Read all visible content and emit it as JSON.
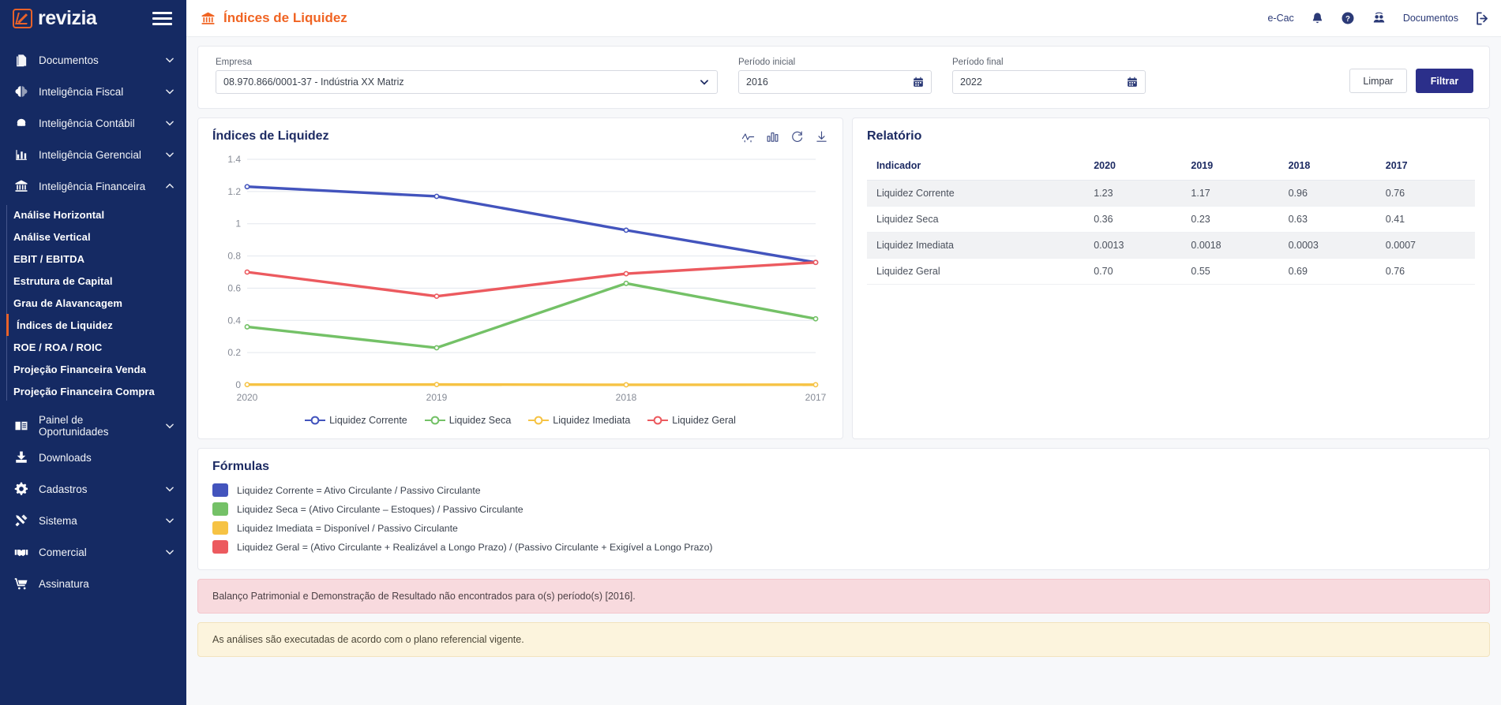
{
  "brand": {
    "name": "revizia",
    "logo_icon": "revizia-logo-icon",
    "menu_icon": "hamburger-icon"
  },
  "sidebar": {
    "items": [
      {
        "label": "Documentos",
        "icon": "documents-icon",
        "expandable": true,
        "expanded": false
      },
      {
        "label": "Inteligência Fiscal",
        "icon": "brain-icon",
        "expandable": true,
        "expanded": false
      },
      {
        "label": "Inteligência Contábil",
        "icon": "cloud-icon",
        "expandable": true,
        "expanded": false
      },
      {
        "label": "Inteligência Gerencial",
        "icon": "bar-chart-icon",
        "expandable": true,
        "expanded": false
      },
      {
        "label": "Inteligência Financeira",
        "icon": "bank-icon",
        "expandable": true,
        "expanded": true
      }
    ],
    "financeira_subitems": [
      {
        "label": "Análise Horizontal",
        "active": false
      },
      {
        "label": "Análise Vertical",
        "active": false
      },
      {
        "label": "EBIT / EBITDA",
        "active": false
      },
      {
        "label": "Estrutura de Capital",
        "active": false
      },
      {
        "label": "Grau de Alavancagem",
        "active": false
      },
      {
        "label": "Índices de Liquidez",
        "active": true
      },
      {
        "label": "ROE / ROA / ROIC",
        "active": false
      },
      {
        "label": "Projeção Financeira Venda",
        "active": false
      },
      {
        "label": "Projeção Financeira Compra",
        "active": false
      }
    ],
    "items_bottom": [
      {
        "label": "Painel de Oportunidades",
        "icon": "book-icon",
        "expandable": true
      },
      {
        "label": "Downloads",
        "icon": "download-icon",
        "expandable": false
      },
      {
        "label": "Cadastros",
        "icon": "gear-icon",
        "expandable": true
      },
      {
        "label": "Sistema",
        "icon": "tools-icon",
        "expandable": true
      },
      {
        "label": "Comercial",
        "icon": "handshake-icon",
        "expandable": true
      },
      {
        "label": "Assinatura",
        "icon": "cart-icon",
        "expandable": false
      }
    ]
  },
  "topbar": {
    "title": "Índices de Liquidez",
    "title_icon": "bank-icon",
    "ecac_label": "e-Cac",
    "bell_icon": "bell-icon",
    "help_icon": "question-circle-icon",
    "users_icon": "users-icon",
    "documents_label": "Documentos",
    "logout_icon": "logout-icon"
  },
  "filters": {
    "empresa": {
      "label": "Empresa",
      "value": "08.970.866/0001-37 - Indústria XX Matriz",
      "caret_icon": "chevron-down-icon"
    },
    "periodo_inicial": {
      "label": "Período inicial",
      "value": "2016",
      "icon": "calendar-icon"
    },
    "periodo_final": {
      "label": "Período final",
      "value": "2022",
      "icon": "calendar-icon"
    },
    "clear_label": "Limpar",
    "filter_label": "Filtrar"
  },
  "chart_panel": {
    "title": "Índices de Liquidez",
    "tools": [
      {
        "icon": "line-chart-icon",
        "name": "line-chart-toggle"
      },
      {
        "icon": "bar-chart-icon",
        "name": "bar-chart-toggle"
      },
      {
        "icon": "refresh-icon",
        "name": "refresh-button"
      },
      {
        "icon": "download-icon",
        "name": "download-button"
      }
    ]
  },
  "chart_data": {
    "type": "line",
    "title": "Índices de Liquidez",
    "xlabel": "",
    "ylabel": "",
    "categories": [
      "2020",
      "2019",
      "2018",
      "2017"
    ],
    "ylim": [
      0,
      1.4
    ],
    "yticks": [
      0,
      0.2,
      0.4,
      0.6,
      0.8,
      1,
      1.2,
      1.4
    ],
    "ytick_labels": [
      "0",
      "0.2",
      "0.4",
      "0.6",
      "0.8",
      "1",
      "1.2",
      "1.4"
    ],
    "grid": true,
    "legend_position": "bottom",
    "series": [
      {
        "name": "Liquidez Corrente",
        "color": "#4354bd",
        "values": [
          1.23,
          1.17,
          0.96,
          0.76
        ]
      },
      {
        "name": "Liquidez Seca",
        "color": "#74c167",
        "values": [
          0.36,
          0.23,
          0.63,
          0.41
        ]
      },
      {
        "name": "Liquidez Imediata",
        "color": "#f6c344",
        "values": [
          0.0013,
          0.0018,
          0.0003,
          0.0007
        ]
      },
      {
        "name": "Liquidez Geral",
        "color": "#ec5a5f",
        "values": [
          0.7,
          0.55,
          0.69,
          0.76
        ]
      }
    ]
  },
  "report": {
    "title": "Relatório",
    "columns": [
      "Indicador",
      "2020",
      "2019",
      "2018",
      "2017"
    ],
    "rows": [
      {
        "indicador": "Liquidez Corrente",
        "v2020": "1.23",
        "v2019": "1.17",
        "v2018": "0.96",
        "v2017": "0.76"
      },
      {
        "indicador": "Liquidez Seca",
        "v2020": "0.36",
        "v2019": "0.23",
        "v2018": "0.63",
        "v2017": "0.41"
      },
      {
        "indicador": "Liquidez Imediata",
        "v2020": "0.0013",
        "v2019": "0.0018",
        "v2018": "0.0003",
        "v2017": "0.0007"
      },
      {
        "indicador": "Liquidez Geral",
        "v2020": "0.70",
        "v2019": "0.55",
        "v2018": "0.69",
        "v2017": "0.76"
      }
    ]
  },
  "formulas": {
    "title": "Fórmulas",
    "items": [
      {
        "color": "#4354bd",
        "text": "Liquidez Corrente = Ativo Circulante / Passivo Circulante"
      },
      {
        "color": "#74c167",
        "text": "Liquidez Seca = (Ativo Circulante – Estoques) / Passivo Circulante"
      },
      {
        "color": "#f6c344",
        "text": "Liquidez Imediata = Disponível / Passivo Circulante"
      },
      {
        "color": "#ec5a5f",
        "text": "Liquidez Geral = (Ativo Circulante + Realizável a Longo Prazo) / (Passivo Circulante + Exigível a Longo Prazo)"
      }
    ]
  },
  "alerts": [
    {
      "type": "danger",
      "text": "Balanço Patrimonial e Demonstração de Resultado não encontrados para o(s) período(s) [2016]."
    },
    {
      "type": "warning",
      "text": "As análises são executadas de acordo com o plano referencial vigente."
    }
  ],
  "colors": {
    "sidebar_bg": "#152a63",
    "accent_orange": "#e8622a",
    "primary_blue": "#2b2f8a",
    "title_navy": "#1d2b63"
  }
}
